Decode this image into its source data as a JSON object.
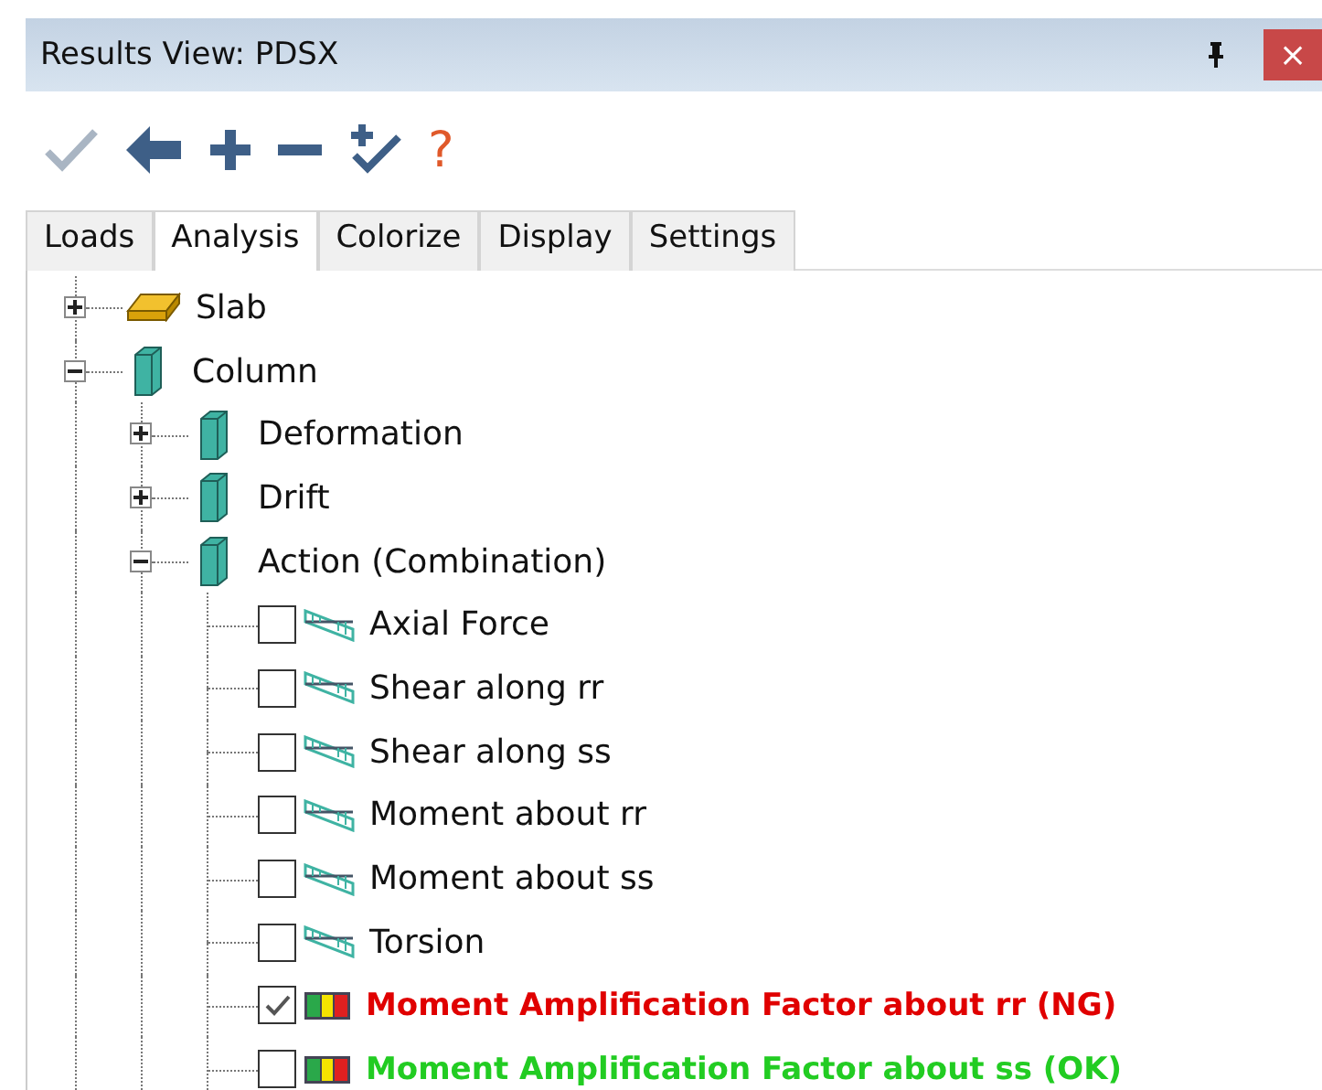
{
  "window": {
    "title": "Results View: PDSX",
    "close": "×"
  },
  "toolbar": [
    {
      "kind": "check",
      "disabled": true
    },
    {
      "kind": "back",
      "disabled": false
    },
    {
      "kind": "plus",
      "disabled": false
    },
    {
      "kind": "minus",
      "disabled": false
    },
    {
      "kind": "check-plus",
      "disabled": false
    },
    {
      "kind": "help",
      "label": "?",
      "disabled": false
    }
  ],
  "tabs": [
    {
      "label": "Loads",
      "selected": false
    },
    {
      "label": "Analysis",
      "selected": true
    },
    {
      "label": "Colorize",
      "selected": false
    },
    {
      "label": "Display",
      "selected": false
    },
    {
      "label": "Settings",
      "selected": false
    }
  ],
  "tree": [
    {
      "label": "Slab",
      "kind": "slab",
      "expanded": false
    },
    {
      "label": "Column",
      "kind": "column",
      "expanded": true,
      "children": [
        {
          "label": "Deformation",
          "kind": "column",
          "expanded": false
        },
        {
          "label": "Drift",
          "kind": "column",
          "expanded": false
        },
        {
          "label": "Action (Combination)",
          "kind": "column",
          "expanded": true,
          "children": [
            {
              "label": "Axial Force",
              "kind": "diagram",
              "checked": false
            },
            {
              "label": "Shear along rr",
              "kind": "diagram",
              "checked": false
            },
            {
              "label": "Shear along ss",
              "kind": "diagram",
              "checked": false
            },
            {
              "label": "Moment about rr",
              "kind": "diagram",
              "checked": false
            },
            {
              "label": "Moment about ss",
              "kind": "diagram",
              "checked": false
            },
            {
              "label": "Torsion",
              "kind": "diagram",
              "checked": false
            },
            {
              "label": "Moment Amplification Factor about rr (NG)",
              "kind": "ratio",
              "checked": true,
              "color": "#e00000"
            },
            {
              "label": "Moment Amplification Factor about ss (OK)",
              "kind": "ratio",
              "checked": false,
              "color": "#22cc22"
            }
          ]
        }
      ]
    }
  ]
}
